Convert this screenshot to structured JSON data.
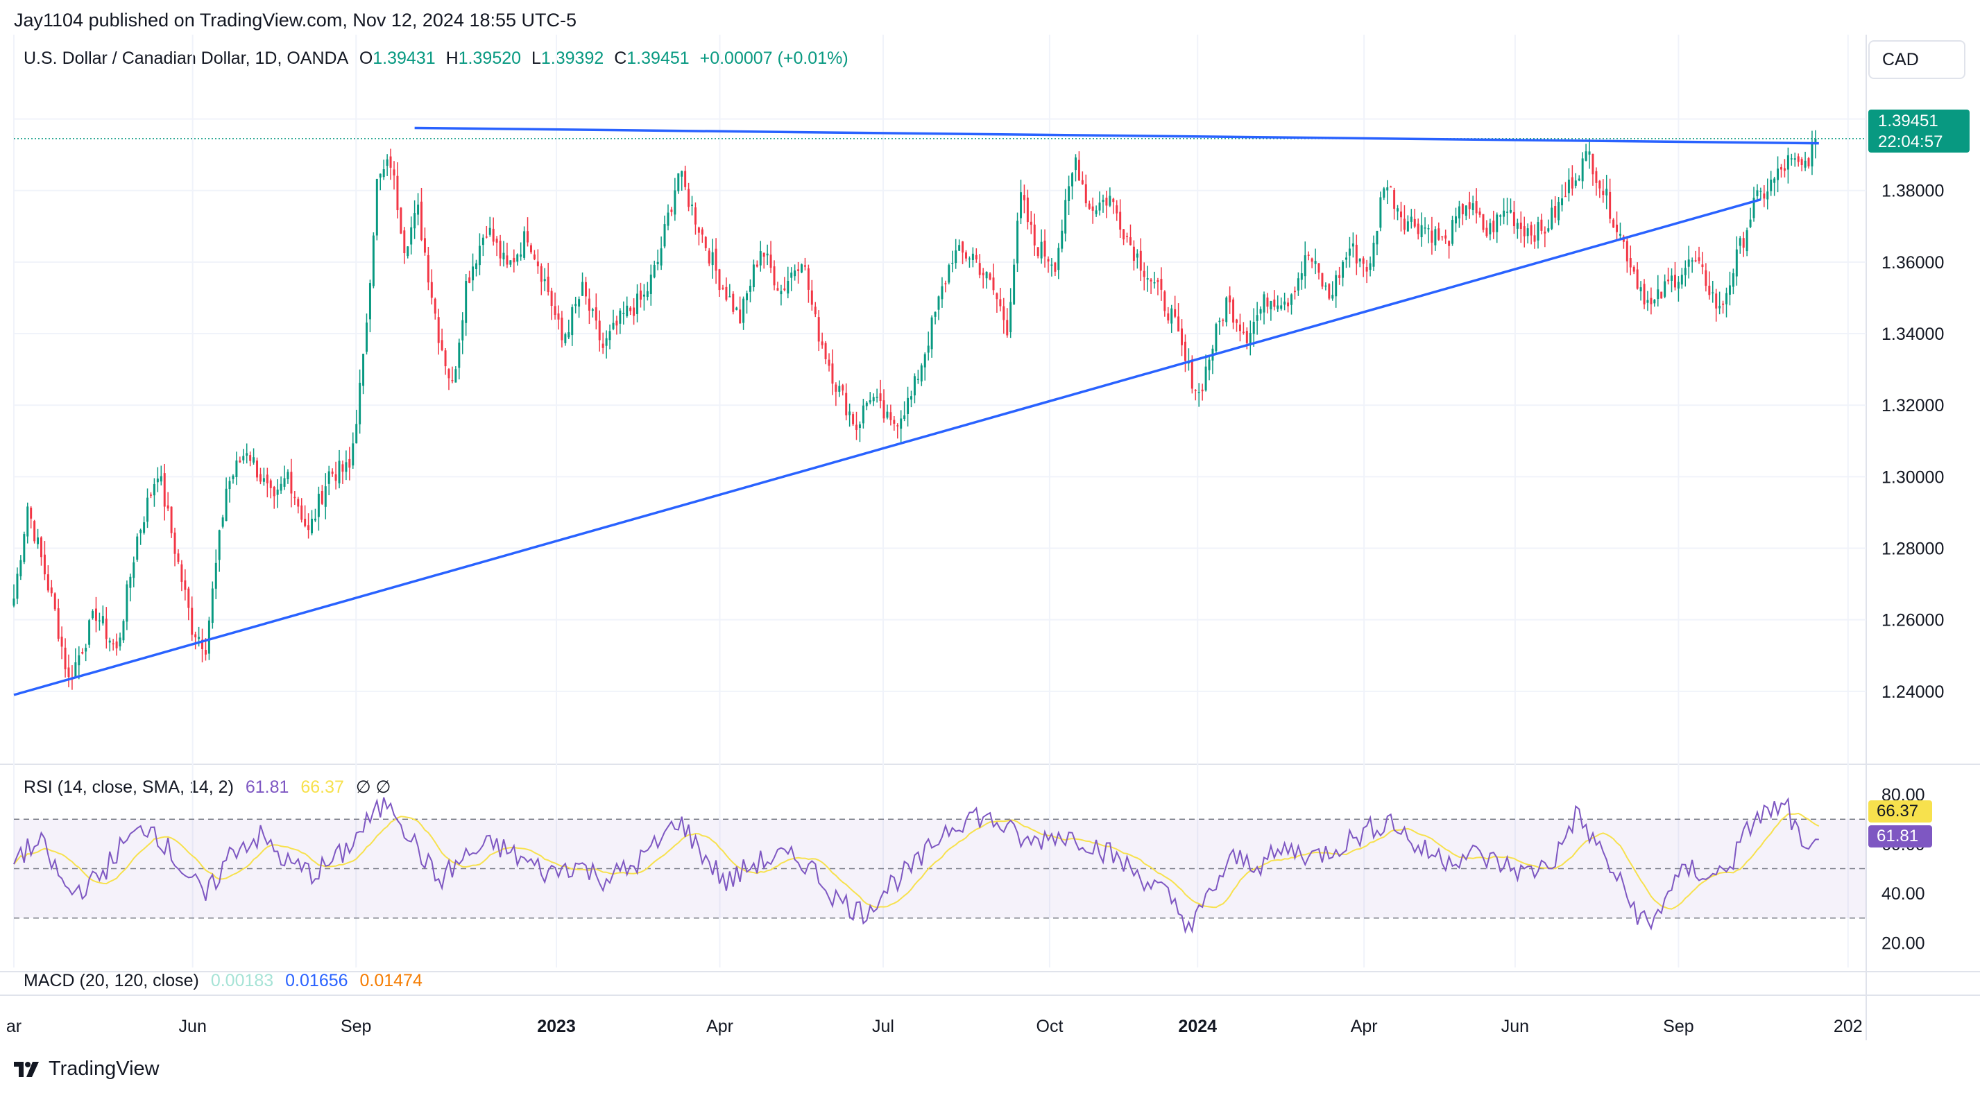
{
  "publisher": "Jay1104 published on TradingView.com, Nov 12, 2024 18:55 UTC-5",
  "header": {
    "symbol": "U.S. Dollar / Canadian Dollar, 1D, OANDA",
    "o_label": "O",
    "o_value": "1.39431",
    "h_label": "H",
    "h_value": "1.39520",
    "l_label": "L",
    "l_value": "1.39392",
    "c_label": "C",
    "c_value": "1.39451",
    "change": "+0.00007 (+0.01%)"
  },
  "currency_button": "CAD",
  "price_badge": {
    "price": "1.39451",
    "countdown": "22:04:57"
  },
  "rsi_legend": {
    "label": "RSI (14, close, SMA, 14, 2)",
    "rsi": "61.81",
    "sma": "66.37",
    "extra": "∅ ∅"
  },
  "rsi_badges": {
    "sma": "66.37",
    "rsi": "61.81"
  },
  "macd_legend": {
    "label": "MACD (20, 120, close)",
    "a": "0.00183",
    "b": "0.01656",
    "c": "0.01474"
  },
  "footer": {
    "brand": "TradingView"
  },
  "colors": {
    "up": "#089981",
    "down": "#f23645",
    "trendline": "#2962ff",
    "rsi": "#7e57c2",
    "rsi_sma": "#f7e14d",
    "badge_green": "#089981"
  },
  "chart_data": {
    "type": "candlestick",
    "price_axis": {
      "ticks": [
        "1.40000",
        "1.38000",
        "1.36000",
        "1.34000",
        "1.32000",
        "1.30000",
        "1.28000",
        "1.26000",
        "1.24000"
      ]
    },
    "rsi_axis": {
      "ticks": [
        "80.00",
        "60.00",
        "40.00",
        "20.00"
      ],
      "bands": [
        70,
        50,
        30
      ]
    },
    "time_axis": [
      "ar",
      "Jun",
      "Sep",
      "2023",
      "Apr",
      "Jul",
      "Oct",
      "2024",
      "Apr",
      "Jun",
      "Sep",
      "202"
    ],
    "close_path": [
      [
        0,
        1.266
      ],
      [
        4,
        1.292
      ],
      [
        12,
        1.262
      ],
      [
        16,
        1.243
      ],
      [
        24,
        1.262
      ],
      [
        30,
        1.251
      ],
      [
        36,
        1.283
      ],
      [
        42,
        1.302
      ],
      [
        52,
        1.258
      ],
      [
        56,
        1.253
      ],
      [
        62,
        1.297
      ],
      [
        68,
        1.308
      ],
      [
        76,
        1.292
      ],
      [
        80,
        1.301
      ],
      [
        86,
        1.284
      ],
      [
        92,
        1.301
      ],
      [
        98,
        1.302
      ],
      [
        102,
        1.332
      ],
      [
        106,
        1.382
      ],
      [
        110,
        1.388
      ],
      [
        114,
        1.365
      ],
      [
        118,
        1.374
      ],
      [
        124,
        1.34
      ],
      [
        128,
        1.325
      ],
      [
        132,
        1.354
      ],
      [
        138,
        1.37
      ],
      [
        144,
        1.358
      ],
      [
        150,
        1.368
      ],
      [
        156,
        1.352
      ],
      [
        160,
        1.338
      ],
      [
        166,
        1.352
      ],
      [
        172,
        1.336
      ],
      [
        178,
        1.345
      ],
      [
        184,
        1.35
      ],
      [
        188,
        1.36
      ],
      [
        194,
        1.385
      ],
      [
        200,
        1.37
      ],
      [
        206,
        1.355
      ],
      [
        212,
        1.344
      ],
      [
        218,
        1.364
      ],
      [
        224,
        1.352
      ],
      [
        230,
        1.362
      ],
      [
        234,
        1.343
      ],
      [
        240,
        1.326
      ],
      [
        246,
        1.314
      ],
      [
        250,
        1.323
      ],
      [
        256,
        1.314
      ],
      [
        262,
        1.322
      ],
      [
        268,
        1.342
      ],
      [
        274,
        1.362
      ],
      [
        280,
        1.362
      ],
      [
        286,
        1.352
      ],
      [
        290,
        1.342
      ],
      [
        294,
        1.378
      ],
      [
        298,
        1.365
      ],
      [
        304,
        1.36
      ],
      [
        310,
        1.389
      ],
      [
        314,
        1.375
      ],
      [
        320,
        1.378
      ],
      [
        326,
        1.365
      ],
      [
        332,
        1.355
      ],
      [
        338,
        1.345
      ],
      [
        342,
        1.332
      ],
      [
        346,
        1.323
      ],
      [
        350,
        1.337
      ],
      [
        354,
        1.349
      ],
      [
        360,
        1.34
      ],
      [
        366,
        1.35
      ],
      [
        372,
        1.35
      ],
      [
        378,
        1.362
      ],
      [
        384,
        1.35
      ],
      [
        390,
        1.364
      ],
      [
        396,
        1.358
      ],
      [
        400,
        1.383
      ],
      [
        406,
        1.372
      ],
      [
        412,
        1.37
      ],
      [
        418,
        1.365
      ],
      [
        424,
        1.377
      ],
      [
        430,
        1.368
      ],
      [
        436,
        1.375
      ],
      [
        440,
        1.37
      ],
      [
        446,
        1.368
      ],
      [
        452,
        1.377
      ],
      [
        456,
        1.385
      ],
      [
        460,
        1.39
      ],
      [
        464,
        1.38
      ],
      [
        468,
        1.37
      ],
      [
        474,
        1.355
      ],
      [
        478,
        1.347
      ],
      [
        484,
        1.355
      ],
      [
        490,
        1.36
      ],
      [
        494,
        1.355
      ],
      [
        498,
        1.346
      ],
      [
        502,
        1.358
      ],
      [
        508,
        1.376
      ],
      [
        514,
        1.383
      ],
      [
        518,
        1.388
      ],
      [
        522,
        1.386
      ],
      [
        526,
        1.393
      ]
    ],
    "trendlines": [
      {
        "name": "resistance",
        "from": [
          117,
          1.3975
        ],
        "to": [
          527,
          1.3932
        ]
      },
      {
        "name": "support",
        "from": [
          0,
          1.239
        ],
        "to": [
          510,
          1.3775
        ]
      }
    ],
    "rsi_path": [
      [
        0,
        55
      ],
      [
        8,
        60
      ],
      [
        16,
        40
      ],
      [
        24,
        45
      ],
      [
        32,
        60
      ],
      [
        40,
        68
      ],
      [
        48,
        52
      ],
      [
        56,
        38
      ],
      [
        64,
        58
      ],
      [
        72,
        63
      ],
      [
        80,
        52
      ],
      [
        88,
        48
      ],
      [
        96,
        56
      ],
      [
        104,
        70
      ],
      [
        110,
        78
      ],
      [
        116,
        62
      ],
      [
        124,
        45
      ],
      [
        132,
        55
      ],
      [
        140,
        60
      ],
      [
        148,
        54
      ],
      [
        156,
        48
      ],
      [
        164,
        52
      ],
      [
        172,
        46
      ],
      [
        180,
        50
      ],
      [
        188,
        60
      ],
      [
        194,
        70
      ],
      [
        200,
        58
      ],
      [
        208,
        44
      ],
      [
        216,
        52
      ],
      [
        224,
        55
      ],
      [
        232,
        52
      ],
      [
        240,
        38
      ],
      [
        248,
        32
      ],
      [
        256,
        44
      ],
      [
        264,
        52
      ],
      [
        272,
        66
      ],
      [
        280,
        72
      ],
      [
        288,
        68
      ],
      [
        296,
        60
      ],
      [
        304,
        64
      ],
      [
        312,
        62
      ],
      [
        320,
        56
      ],
      [
        328,
        48
      ],
      [
        336,
        40
      ],
      [
        344,
        26
      ],
      [
        350,
        42
      ],
      [
        356,
        54
      ],
      [
        364,
        52
      ],
      [
        372,
        58
      ],
      [
        380,
        55
      ],
      [
        388,
        60
      ],
      [
        396,
        66
      ],
      [
        402,
        70
      ],
      [
        410,
        58
      ],
      [
        418,
        54
      ],
      [
        426,
        56
      ],
      [
        434,
        52
      ],
      [
        442,
        48
      ],
      [
        450,
        54
      ],
      [
        456,
        72
      ],
      [
        462,
        60
      ],
      [
        468,
        46
      ],
      [
        474,
        32
      ],
      [
        478,
        26
      ],
      [
        484,
        44
      ],
      [
        490,
        50
      ],
      [
        496,
        46
      ],
      [
        502,
        54
      ],
      [
        508,
        70
      ],
      [
        514,
        74
      ],
      [
        518,
        74
      ],
      [
        522,
        58
      ],
      [
        524,
        54
      ],
      [
        527,
        61.81
      ]
    ],
    "rsi_sma_last": 66.37,
    "rsi_last": 61.81,
    "last_price": 1.39451
  }
}
